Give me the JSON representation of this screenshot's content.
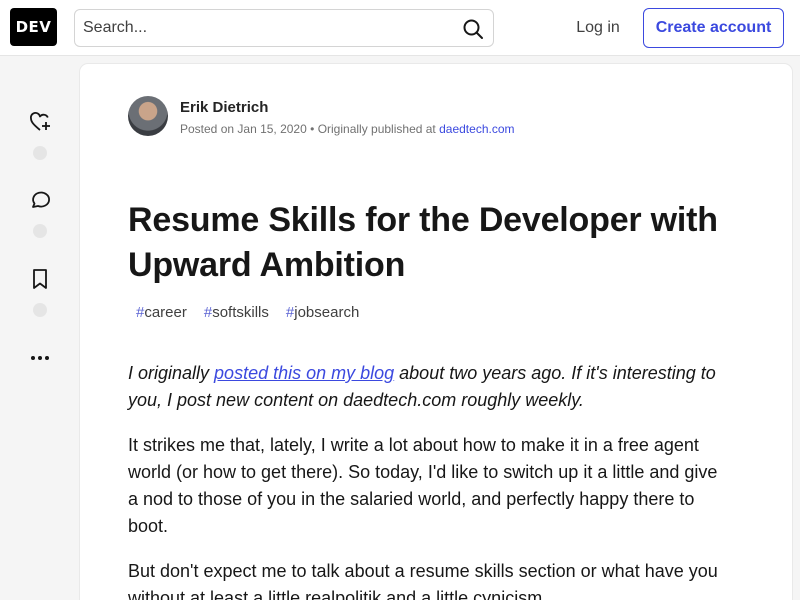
{
  "header": {
    "logo": "DEV",
    "search_placeholder": "Search...",
    "login": "Log in",
    "create_account": "Create account"
  },
  "sidebar": {
    "icons": [
      "heart-plus-icon",
      "comment-icon",
      "bookmark-icon",
      "more-icon"
    ]
  },
  "article": {
    "author": "Erik Dietrich",
    "posted_prefix": "Posted on",
    "date": "Jan 15, 2020",
    "separator": "•",
    "originally_published": "Originally published at",
    "source": "daedtech.com",
    "title": "Resume Skills for the Developer with Upward Ambition",
    "tags": [
      {
        "hash": "#",
        "name": "career"
      },
      {
        "hash": "#",
        "name": "softskills"
      },
      {
        "hash": "#",
        "name": "jobsearch"
      }
    ],
    "p1_start": "I originally ",
    "p1_link": "posted this on my blog",
    "p1_end": " about two years ago. If it's interesting to you, I post new content on daedtech.com roughly weekly.",
    "p2": "It strikes me that, lately, I write a lot about how to make it in a free agent world (or how to get there).  So today, I'd like to switch up it a little and give a nod to those of you in the salaried world, and perfectly happy there to boot.",
    "p3": "But don't expect me to talk about a resume skills section or what have you without at least a little realpolitik and a little cynicism."
  }
}
